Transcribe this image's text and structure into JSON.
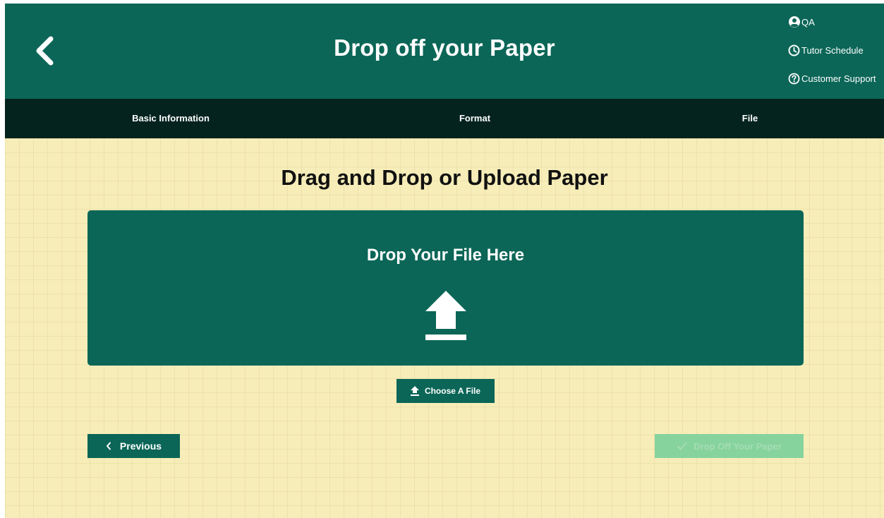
{
  "header": {
    "title": "Drop off your Paper",
    "back_icon": "chevron-left-icon",
    "user_links": [
      {
        "label": "QA",
        "icon": "user-circle-icon"
      },
      {
        "label": "Tutor Schedule",
        "icon": "clock-icon"
      },
      {
        "label": "Customer Support",
        "icon": "question-circle-icon"
      }
    ]
  },
  "steps": [
    {
      "label": "Basic Information"
    },
    {
      "label": "Format"
    },
    {
      "label": "File"
    }
  ],
  "main": {
    "section_title": "Drag and Drop or Upload Paper",
    "dropzone": {
      "title": "Drop Your File Here",
      "icon": "upload-icon"
    },
    "choose_file_label": "Choose A File",
    "previous_label": "Previous",
    "dropoff_label": "Drop Off Your Paper"
  },
  "colors": {
    "primary": "#0b6657",
    "stepbar": "#04231f",
    "background": "#f7edb9",
    "disabled_button": "#86d39d"
  }
}
